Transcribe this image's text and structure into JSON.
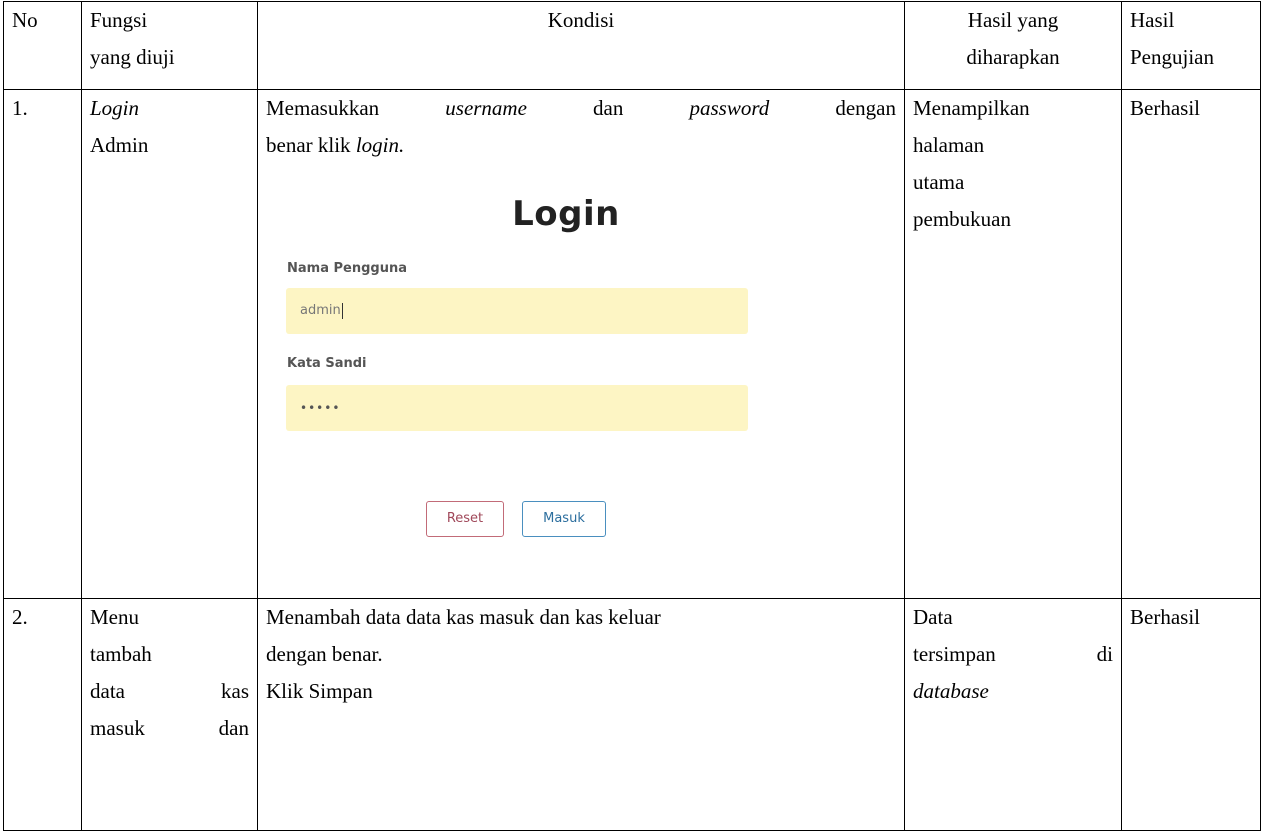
{
  "table": {
    "headers": {
      "no": "No",
      "fungsi": [
        "Fungsi",
        "yang diuji"
      ],
      "kondisi": "Kondisi",
      "hasil_harapan": [
        "Hasil yang",
        "diharapkan"
      ],
      "hasil_uji": [
        "Hasil",
        "Pengujian"
      ]
    },
    "row1": {
      "no": "1.",
      "fungsi_line1": "Login",
      "fungsi_line2": "Admin",
      "kondisi_line1": {
        "a": "Memasukkan",
        "b": "username",
        "c": "dan",
        "d": "password",
        "e": "dengan"
      },
      "kondisi_line2_pre": "benar klik ",
      "kondisi_line2_italic": "login.",
      "hasil_harapan": [
        "Menampilkan",
        "halaman",
        "utama",
        "pembukuan"
      ],
      "hasil_uji": "Berhasil"
    },
    "row2": {
      "no": "2.",
      "fungsi": {
        "l1": "Menu",
        "l2": "tambah",
        "l3a": "data",
        "l3b": "kas",
        "l4a": "masuk",
        "l4b": "dan"
      },
      "kondisi": [
        "Menambah data data kas masuk dan kas keluar",
        "dengan benar.",
        "Klik Simpan"
      ],
      "hasil_harapan": {
        "l1": "Data",
        "l2a": "tersimpan",
        "l2b": "di",
        "l3": "database"
      },
      "hasil_uji": "Berhasil"
    }
  },
  "login_screenshot": {
    "title": "Login",
    "username_label": "Nama Pengguna",
    "username_value": "admin",
    "password_label": "Kata Sandi",
    "password_value": "•••••",
    "reset_label": "Reset",
    "masuk_label": "Masuk",
    "field_color": "#fdf5c4",
    "reset_color": "#c26b78",
    "masuk_color": "#4a8fbf"
  }
}
